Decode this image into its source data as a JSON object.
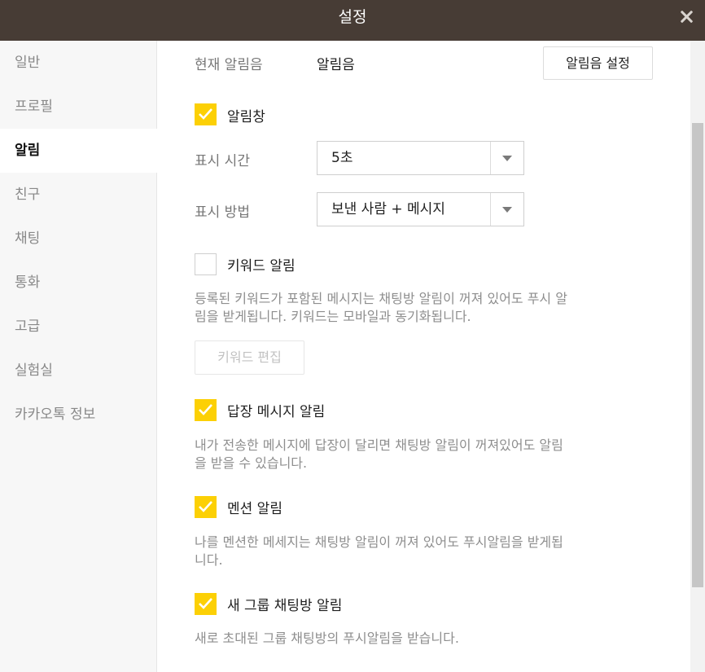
{
  "window": {
    "title": "설정"
  },
  "sidebar": {
    "items": [
      {
        "label": "일반",
        "active": false
      },
      {
        "label": "프로필",
        "active": false
      },
      {
        "label": "알림",
        "active": true
      },
      {
        "label": "친구",
        "active": false
      },
      {
        "label": "채팅",
        "active": false
      },
      {
        "label": "통화",
        "active": false
      },
      {
        "label": "고급",
        "active": false
      },
      {
        "label": "실험실",
        "active": false
      },
      {
        "label": "카카오톡 정보",
        "active": false
      }
    ]
  },
  "sound": {
    "label": "현재 알림음",
    "value": "알림음",
    "button": "알림음 설정"
  },
  "popup": {
    "label": "알림창",
    "checked": true
  },
  "display_time": {
    "label": "표시 시간",
    "value": "5초"
  },
  "display_method": {
    "label": "표시 방법",
    "value": "보낸 사람 + 메시지"
  },
  "keyword": {
    "label": "키워드 알림",
    "checked": false,
    "desc1": "등록된 키워드가 포함된 메시지는 채팅방 알림이 꺼져 있어도 푸시 알",
    "desc2": "림을 받게됩니다. 키워드는 모바일과 동기화됩니다.",
    "button": "키워드 편집"
  },
  "reply": {
    "label": "답장 메시지 알림",
    "checked": true,
    "desc1": "내가 전송한 메시지에 답장이 달리면 채팅방 알림이 꺼져있어도 알림",
    "desc2": "을 받을 수 있습니다."
  },
  "mention": {
    "label": "멘션 알림",
    "checked": true,
    "desc1": "나를 멘션한 메세지는 채팅방 알림이 꺼져 있어도 푸시알림을 받게됩",
    "desc2": "니다."
  },
  "new_group": {
    "label": "새 그룹 채팅방 알림",
    "checked": true,
    "desc1": "새로 초대된 그룹 채팅방의 푸시알림을 받습니다."
  },
  "colors": {
    "titlebar": "#473c35",
    "accent": "#fcd005"
  }
}
